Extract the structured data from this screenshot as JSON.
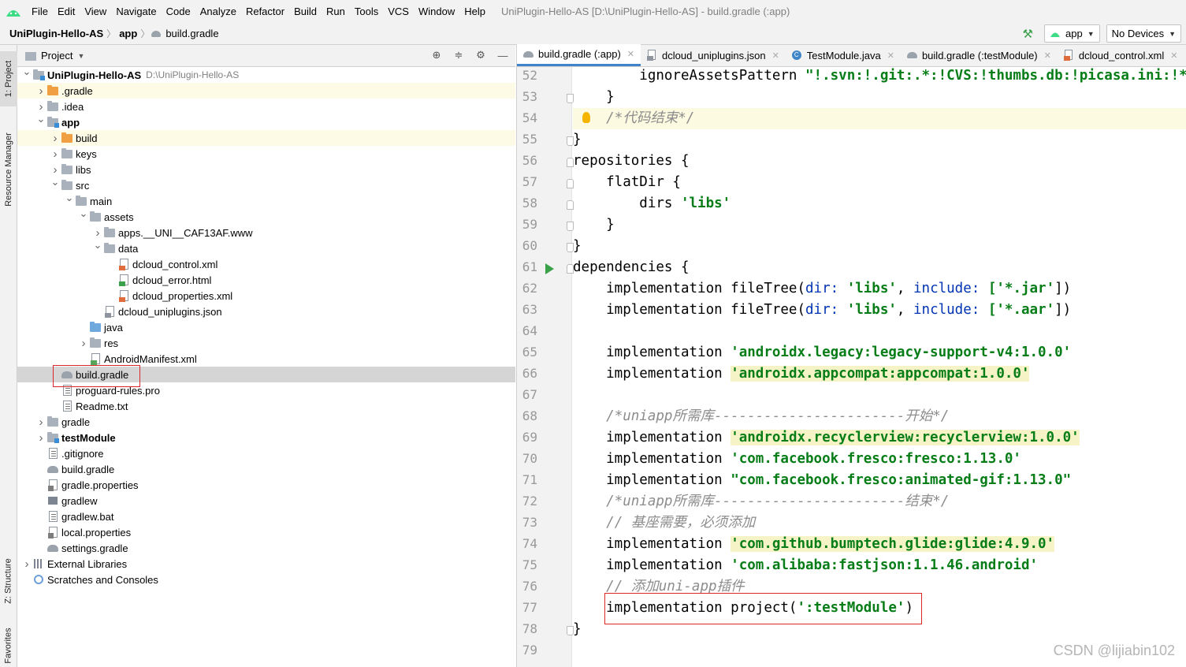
{
  "menubar": {
    "items": [
      "File",
      "Edit",
      "View",
      "Navigate",
      "Code",
      "Analyze",
      "Refactor",
      "Build",
      "Run",
      "Tools",
      "VCS",
      "Window",
      "Help"
    ],
    "window_title": "UniPlugin-Hello-AS [D:\\UniPlugin-Hello-AS] - build.gradle (:app)"
  },
  "navbar": {
    "crumbs": [
      "UniPlugin-Hello-AS",
      "app",
      "build.gradle"
    ],
    "run_config": "app",
    "device": "No Devices"
  },
  "left_strip": {
    "tabs": [
      "1: Project",
      "Resource Manager",
      "Z: Structure",
      "Favorites"
    ]
  },
  "project_panel": {
    "title": "Project",
    "tree": [
      {
        "label": "UniPlugin-Hello-AS",
        "extra": "D:\\UniPlugin-Hello-AS",
        "bold": true,
        "depth": 0,
        "icon": "module",
        "chev": "down"
      },
      {
        "label": ".gradle",
        "depth": 1,
        "icon": "folder-orange",
        "chev": "right",
        "hl": true
      },
      {
        "label": ".idea",
        "depth": 1,
        "icon": "folder",
        "chev": "right"
      },
      {
        "label": "app",
        "depth": 1,
        "icon": "module",
        "chev": "down",
        "bold": true
      },
      {
        "label": "build",
        "depth": 2,
        "icon": "folder-orange",
        "chev": "right",
        "hl": true
      },
      {
        "label": "keys",
        "depth": 2,
        "icon": "folder",
        "chev": "right"
      },
      {
        "label": "libs",
        "depth": 2,
        "icon": "folder",
        "chev": "right"
      },
      {
        "label": "src",
        "depth": 2,
        "icon": "folder",
        "chev": "down"
      },
      {
        "label": "main",
        "depth": 3,
        "icon": "folder",
        "chev": "down"
      },
      {
        "label": "assets",
        "depth": 4,
        "icon": "folder-res",
        "chev": "down"
      },
      {
        "label": "apps.__UNI__CAF13AF.www",
        "depth": 5,
        "icon": "folder",
        "chev": "right"
      },
      {
        "label": "data",
        "depth": 5,
        "icon": "folder",
        "chev": "down"
      },
      {
        "label": "dcloud_control.xml",
        "depth": 6,
        "icon": "xml"
      },
      {
        "label": "dcloud_error.html",
        "depth": 6,
        "icon": "html"
      },
      {
        "label": "dcloud_properties.xml",
        "depth": 6,
        "icon": "xml"
      },
      {
        "label": "dcloud_uniplugins.json",
        "depth": 5,
        "icon": "json"
      },
      {
        "label": "java",
        "depth": 4,
        "icon": "folder-blue"
      },
      {
        "label": "res",
        "depth": 4,
        "icon": "folder-res",
        "chev": "right"
      },
      {
        "label": "AndroidManifest.xml",
        "depth": 4,
        "icon": "manifest"
      },
      {
        "label": "build.gradle",
        "depth": 2,
        "icon": "gradle",
        "sel": true
      },
      {
        "label": "proguard-rules.pro",
        "depth": 2,
        "icon": "txt"
      },
      {
        "label": "Readme.txt",
        "depth": 2,
        "icon": "txt"
      },
      {
        "label": "gradle",
        "depth": 1,
        "icon": "folder",
        "chev": "right"
      },
      {
        "label": "testModule",
        "depth": 1,
        "icon": "module",
        "chev": "right",
        "bold": true
      },
      {
        "label": ".gitignore",
        "depth": 1,
        "icon": "txt"
      },
      {
        "label": "build.gradle",
        "depth": 1,
        "icon": "gradle"
      },
      {
        "label": "gradle.properties",
        "depth": 1,
        "icon": "props"
      },
      {
        "label": "gradlew",
        "depth": 1,
        "icon": "term"
      },
      {
        "label": "gradlew.bat",
        "depth": 1,
        "icon": "txt"
      },
      {
        "label": "local.properties",
        "depth": 1,
        "icon": "props"
      },
      {
        "label": "settings.gradle",
        "depth": 1,
        "icon": "gradle"
      },
      {
        "label": "External Libraries",
        "depth": 0,
        "icon": "libs",
        "chev": "right"
      },
      {
        "label": "Scratches and Consoles",
        "depth": 0,
        "icon": "scratch"
      }
    ]
  },
  "editor": {
    "tabs": [
      {
        "label": "build.gradle (:app)",
        "icon": "gradle",
        "active": true
      },
      {
        "label": "dcloud_uniplugins.json",
        "icon": "json"
      },
      {
        "label": "TestModule.java",
        "icon": "class"
      },
      {
        "label": "build.gradle (:testModule)",
        "icon": "gradle"
      },
      {
        "label": "dcloud_control.xml",
        "icon": "xml"
      }
    ],
    "lines": [
      {
        "n": "52",
        "segs": [
          [
            "        ignoreAssetsPattern ",
            ""
          ],
          [
            "\"!.svn:!.git:.*:!CVS:!thumbs.db:!picasa.ini:!*.scc",
            "s"
          ]
        ]
      },
      {
        "n": "53",
        "segs": [
          [
            "    }",
            ""
          ]
        ]
      },
      {
        "n": "54",
        "cur": true,
        "segs": [
          [
            "    ",
            ""
          ],
          [
            "/*代码结束*/",
            "cm"
          ]
        ]
      },
      {
        "n": "55",
        "segs": [
          [
            "}",
            ""
          ]
        ]
      },
      {
        "n": "56",
        "segs": [
          [
            "repositories {",
            ""
          ]
        ]
      },
      {
        "n": "57",
        "segs": [
          [
            "    flatDir {",
            ""
          ]
        ]
      },
      {
        "n": "58",
        "segs": [
          [
            "        dirs ",
            ""
          ],
          [
            "'libs'",
            "s"
          ]
        ]
      },
      {
        "n": "59",
        "segs": [
          [
            "    }",
            ""
          ]
        ]
      },
      {
        "n": "60",
        "segs": [
          [
            "}",
            ""
          ]
        ]
      },
      {
        "n": "61",
        "segs": [
          [
            "dependencies {",
            ""
          ]
        ]
      },
      {
        "n": "62",
        "segs": [
          [
            "    implementation fileTree(",
            ""
          ],
          [
            "dir: ",
            "k"
          ],
          [
            "'libs'",
            "s"
          ],
          [
            ", ",
            ""
          ],
          [
            "include: ",
            "k"
          ],
          [
            "['",
            "s"
          ],
          [
            "*.jar",
            "s"
          ],
          [
            "'",
            "s"
          ],
          [
            "])",
            ""
          ]
        ]
      },
      {
        "n": "63",
        "segs": [
          [
            "    implementation fileTree(",
            ""
          ],
          [
            "dir: ",
            "k"
          ],
          [
            "'libs'",
            "s"
          ],
          [
            ", ",
            ""
          ],
          [
            "include: ",
            "k"
          ],
          [
            "['",
            "s"
          ],
          [
            "*.aar",
            "s"
          ],
          [
            "'",
            "s"
          ],
          [
            "])",
            ""
          ]
        ]
      },
      {
        "n": "64",
        "segs": [
          [
            "",
            ""
          ]
        ]
      },
      {
        "n": "65",
        "segs": [
          [
            "    implementation ",
            ""
          ],
          [
            "'androidx.legacy:legacy-support-v4:1.0.0'",
            "s"
          ]
        ]
      },
      {
        "n": "66",
        "segs": [
          [
            "    implementation ",
            ""
          ],
          [
            "'androidx.appcompat:appcompat:1.0.0'",
            "s hls"
          ]
        ]
      },
      {
        "n": "67",
        "segs": [
          [
            "",
            ""
          ]
        ]
      },
      {
        "n": "68",
        "segs": [
          [
            "    ",
            ""
          ],
          [
            "/*uniapp所需库-----------------------开始*/",
            "cm"
          ]
        ]
      },
      {
        "n": "69",
        "segs": [
          [
            "    implementation ",
            ""
          ],
          [
            "'androidx.recyclerview:recyclerview:1.0.0'",
            "s hls"
          ]
        ]
      },
      {
        "n": "70",
        "segs": [
          [
            "    implementation ",
            ""
          ],
          [
            "'com.facebook.fresco:fresco:1.13.0'",
            "s"
          ]
        ]
      },
      {
        "n": "71",
        "segs": [
          [
            "    implementation ",
            ""
          ],
          [
            "\"com.facebook.fresco:animated-gif:1.13.0\"",
            "s"
          ]
        ]
      },
      {
        "n": "72",
        "segs": [
          [
            "    ",
            ""
          ],
          [
            "/*uniapp所需库-----------------------结束*/",
            "cm"
          ]
        ]
      },
      {
        "n": "73",
        "segs": [
          [
            "    ",
            ""
          ],
          [
            "// 基座需要，必须添加",
            "cm"
          ]
        ]
      },
      {
        "n": "74",
        "segs": [
          [
            "    implementation ",
            ""
          ],
          [
            "'com.github.bumptech.glide:glide:4.9.0'",
            "s hls"
          ]
        ]
      },
      {
        "n": "75",
        "segs": [
          [
            "    implementation ",
            ""
          ],
          [
            "'com.alibaba:fastjson:1.1.46.android'",
            "s"
          ]
        ]
      },
      {
        "n": "76",
        "segs": [
          [
            "    ",
            ""
          ],
          [
            "// 添加uni-app插件",
            "cm"
          ]
        ]
      },
      {
        "n": "77",
        "segs": [
          [
            "    implementation project(",
            ""
          ],
          [
            "':testModule'",
            "s"
          ],
          [
            ")",
            ""
          ]
        ]
      },
      {
        "n": "78",
        "segs": [
          [
            "}",
            ""
          ]
        ]
      },
      {
        "n": "79",
        "segs": [
          [
            "",
            ""
          ]
        ]
      }
    ]
  },
  "watermark": "CSDN @lijiabin102"
}
